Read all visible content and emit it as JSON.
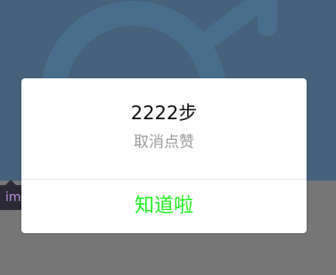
{
  "background": {
    "tag_label": "ima"
  },
  "dialog": {
    "title": "2222步",
    "subtitle": "取消点赞",
    "confirm_label": "知道啦"
  },
  "colors": {
    "accent": "#1ef01e",
    "title": "#111111",
    "subtitle": "#9a9a9a"
  },
  "icons": {
    "background_graphic": "gender-male-symbol-icon"
  }
}
